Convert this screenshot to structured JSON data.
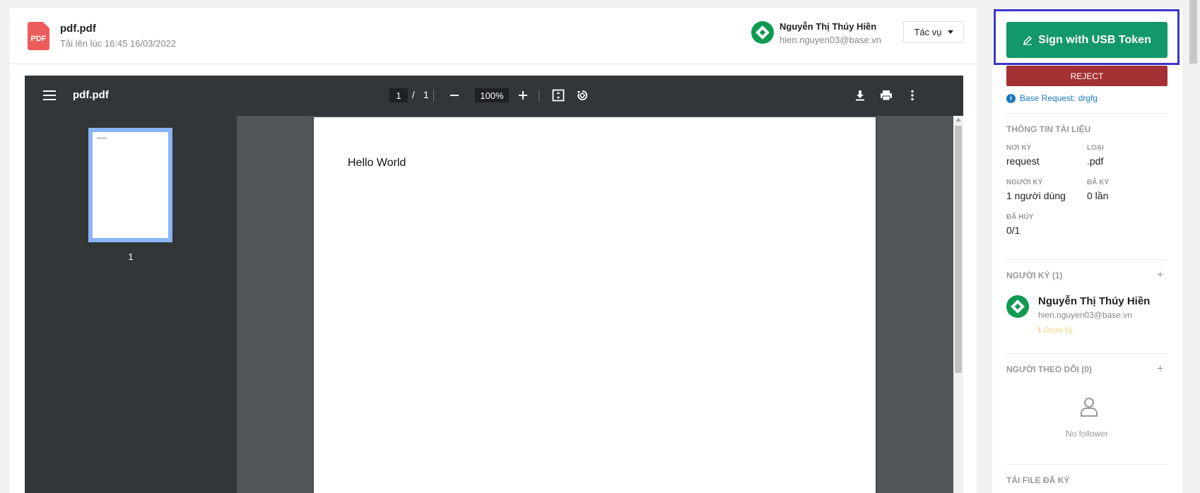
{
  "document": {
    "file_name": "pdf.pdf",
    "file_icon_label": "PDF",
    "uploaded_text": "Tải lên lúc 16:45 16/03/2022",
    "owner": {
      "name": "Nguyễn Thị Thúy Hiền",
      "email": "hien.nguyen03@base.vn"
    },
    "action_button": "Tác vụ"
  },
  "viewer": {
    "title": "pdf.pdf",
    "current_page": "1",
    "page_separator": "/",
    "total_pages": "1",
    "zoom": "100%",
    "thumbnail_label": "1",
    "page_text": "Hello World",
    "icons": [
      "menu-icon",
      "zoom-out-icon",
      "zoom-in-icon",
      "fit-page-icon",
      "rotate-icon",
      "download-icon",
      "print-icon",
      "more-icon"
    ]
  },
  "sidebar": {
    "sign_button": "Sign with USB Token",
    "reject_button": "REJECT",
    "info_icon": "i",
    "base_request_label": "Base Request:",
    "base_request_value": "drgfg",
    "doc_info": {
      "title": "THÔNG TIN TÀI LIỆU",
      "fields": [
        {
          "label": "NƠI KÝ",
          "value": "request"
        },
        {
          "label": "LOẠI",
          "value": ".pdf"
        },
        {
          "label": "NGƯỜI KÝ",
          "value": "1 người dùng"
        },
        {
          "label": "ĐÃ KÝ",
          "value": "0 lần"
        },
        {
          "label": "ĐÃ HỦY",
          "value": "0/1"
        }
      ]
    },
    "signers": {
      "title": "NGƯỜI KÝ (1)",
      "add": "+",
      "items": [
        {
          "name": "Nguyễn Thị Thúy Hiền",
          "email": "hien.nguyen03@base.vn",
          "status": "ℹ Chưa ký"
        }
      ]
    },
    "followers": {
      "title": "NGƯỜI THEO DÕI (0)",
      "add": "+",
      "empty_text": "No follower"
    },
    "download_title": "TẢI FILE ĐÃ KÝ"
  },
  "colors": {
    "sign_button": "#139869",
    "reject_button": "#a33133",
    "highlight_border": "#3c35c8",
    "avatar": "#0f9a52",
    "link": "#1a78c2"
  }
}
